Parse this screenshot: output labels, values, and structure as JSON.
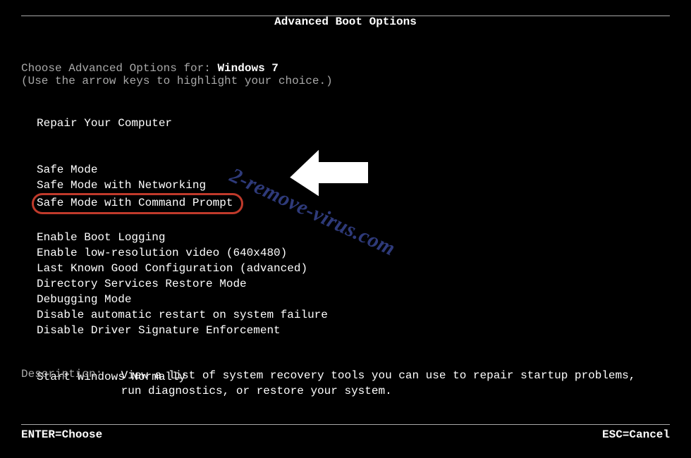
{
  "title": "Advanced Boot Options",
  "prompt": {
    "line1_pre": "Choose Advanced Options for: ",
    "os": "Windows 7",
    "line2": "(Use the arrow keys to highlight your choice.)"
  },
  "menu": {
    "repair": "Repair Your Computer",
    "safe_mode": "Safe Mode",
    "safe_mode_net": "Safe Mode with Networking",
    "safe_mode_cmd": "Safe Mode with Command Prompt",
    "boot_logging": "Enable Boot Logging",
    "low_res": "Enable low-resolution video (640x480)",
    "lkgc": "Last Known Good Configuration (advanced)",
    "dsrm": "Directory Services Restore Mode",
    "debug": "Debugging Mode",
    "no_auto_restart": "Disable automatic restart on system failure",
    "no_drv_sig": "Disable Driver Signature Enforcement",
    "start_normal": "Start Windows Normally"
  },
  "description": {
    "label": "Description:",
    "text": "View a list of system recovery tools you can use to repair startup problems, run diagnostics, or restore your system."
  },
  "footer": {
    "enter": "ENTER=Choose",
    "esc": "ESC=Cancel"
  },
  "watermark": "2-remove-virus.com"
}
